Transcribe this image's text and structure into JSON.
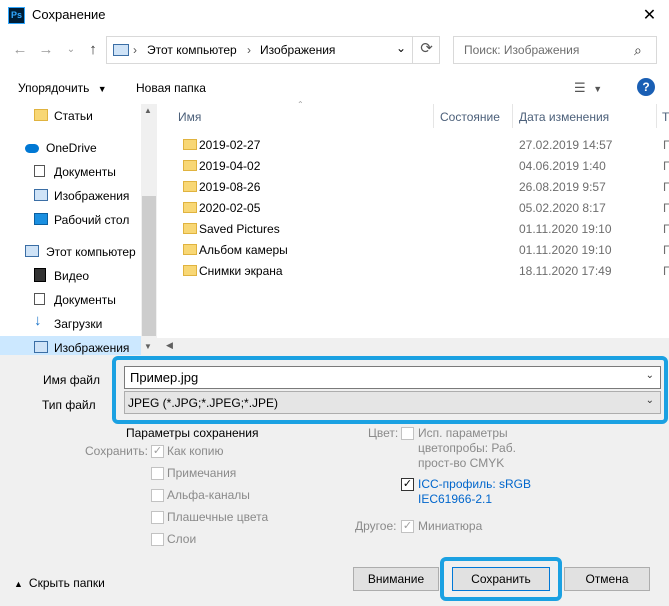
{
  "window": {
    "title": "Сохранение",
    "app_icon_text": "Ps",
    "close_glyph": "✕"
  },
  "address": {
    "crumbs": [
      "Этот компьютер",
      "Изображения"
    ],
    "separator": "›",
    "search_placeholder": "Поиск: Изображения"
  },
  "toolbar": {
    "organize": "Упорядочить",
    "new_folder": "Новая папка",
    "help": "?"
  },
  "nav": {
    "items": [
      {
        "label": "Статьи",
        "icon": "folder-icon"
      },
      {
        "label": "OneDrive",
        "icon": "cloud-icon"
      },
      {
        "label": "Документы",
        "icon": "documents-icon"
      },
      {
        "label": "Изображения",
        "icon": "pictures-icon"
      },
      {
        "label": "Рабочий стол",
        "icon": "desktop-icon"
      },
      {
        "label": "Этот компьютер",
        "icon": "computer-icon"
      },
      {
        "label": "Видео",
        "icon": "video-icon"
      },
      {
        "label": "Документы",
        "icon": "documents-icon"
      },
      {
        "label": "Загрузки",
        "icon": "download-icon"
      },
      {
        "label": "Изображения",
        "icon": "pictures-icon"
      }
    ]
  },
  "files": {
    "columns": [
      "Имя",
      "Состояние",
      "Дата изменения",
      "Т"
    ],
    "rows": [
      {
        "name": "2019-02-27",
        "date": "27.02.2019 14:57",
        "type": "П"
      },
      {
        "name": "2019-04-02",
        "date": "04.06.2019 1:40",
        "type": "П"
      },
      {
        "name": "2019-08-26",
        "date": "26.08.2019 9:57",
        "type": "П"
      },
      {
        "name": "2020-02-05",
        "date": "05.02.2020 8:17",
        "type": "П"
      },
      {
        "name": "Saved Pictures",
        "date": "01.11.2020 19:10",
        "type": "П"
      },
      {
        "name": "Альбом камеры",
        "date": "01.11.2020 19:10",
        "type": "П"
      },
      {
        "name": "Снимки экрана",
        "date": "18.11.2020 17:49",
        "type": "П"
      }
    ]
  },
  "form": {
    "filename_label": "Имя файл",
    "filename_value": "Пример.jpg",
    "filetype_label": "Тип файл",
    "filetype_value": "JPEG (*.JPG;*.JPEG;*.JPE)"
  },
  "save_options": {
    "title": "Параметры сохранения",
    "save_label": "Сохранить:",
    "options": [
      {
        "label": "Как копию",
        "checked": true
      },
      {
        "label": "Примечания",
        "checked": false
      },
      {
        "label": "Альфа-каналы",
        "checked": false
      },
      {
        "label": "Плашечные цвета",
        "checked": false
      },
      {
        "label": "Слои",
        "checked": false
      }
    ],
    "color_label": "Цвет:",
    "proof_lines": [
      "Исп. параметры",
      "цветопробы:  Раб.",
      "прост-во CMYK"
    ],
    "icc_lines": [
      "ICC-профиль:  sRGB",
      "IEC61966-2.1"
    ],
    "other_label": "Другое:",
    "thumbnail_label": "Миниатюра"
  },
  "footer": {
    "hide_folders": "Скрыть папки",
    "warning": "Внимание",
    "save": "Сохранить",
    "cancel": "Отмена"
  },
  "colors": {
    "highlight": "#1ba1e2",
    "selection": "#cce8ff",
    "link": "#0066cc"
  }
}
